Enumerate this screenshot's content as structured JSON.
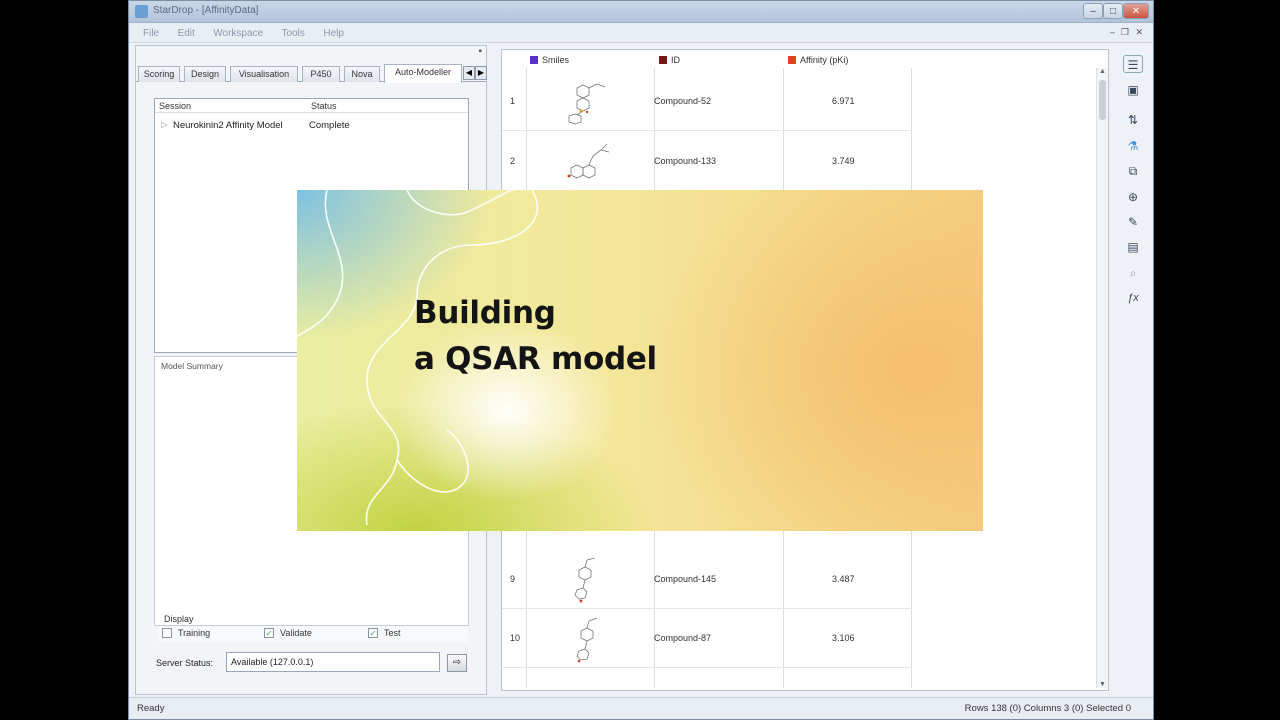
{
  "window": {
    "title": "StarDrop - [AffinityData]"
  },
  "menu": [
    "File",
    "Edit",
    "Workspace",
    "Tools",
    "Help"
  ],
  "tabs": [
    "Scoring",
    "Design",
    "Visualisation",
    "P450",
    "Nova",
    "Auto-Modeller"
  ],
  "session": {
    "col_session": "Session",
    "col_status": "Status",
    "rows": [
      {
        "name": "Neurokinin2 Affinity Model",
        "status": "Complete"
      }
    ]
  },
  "model_summary_label": "Model Summary",
  "display": {
    "label": "Display",
    "options": [
      {
        "label": "Training",
        "checked": false
      },
      {
        "label": "Validate",
        "checked": true
      },
      {
        "label": "Test",
        "checked": true
      }
    ]
  },
  "server": {
    "label": "Server Status:",
    "value": "Available (127.0.0.1)"
  },
  "table": {
    "columns": [
      {
        "label": "Smiles",
        "color": "#5b2fd6"
      },
      {
        "label": "ID",
        "color": "#7a1616"
      },
      {
        "label": "Affinity (pKi)",
        "color": "#e0431f"
      }
    ],
    "rows": [
      {
        "num": "1",
        "id": "Compound-52",
        "affinity": "6.971"
      },
      {
        "num": "2",
        "id": "Compound-133",
        "affinity": "3.749"
      },
      {
        "num": "9",
        "id": "Compound-145",
        "affinity": "3.487"
      },
      {
        "num": "10",
        "id": "Compound-87",
        "affinity": "3.106"
      }
    ]
  },
  "status": {
    "left": "Ready",
    "right": "Rows 138 (0) Columns 3 (0) Selected 0"
  },
  "overlay": {
    "line1": "Building",
    "line2": "a QSAR model"
  },
  "toolbar_icons": [
    "list-icon",
    "save-icon",
    "sort-icon",
    "flask-icon",
    "copy-icon",
    "zoom-icon",
    "paint-icon",
    "chart-icon",
    "search-icon",
    "formula-icon"
  ]
}
